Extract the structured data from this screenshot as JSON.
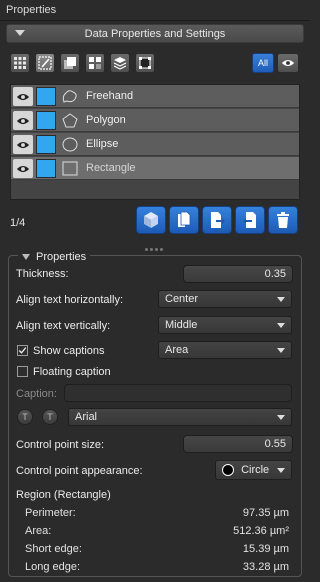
{
  "panel": {
    "title": "Properties"
  },
  "section": {
    "label": "Data Properties and Settings"
  },
  "toolbar": {
    "tools": [
      "grid-icon",
      "freehand-edit-icon",
      "overlay-icon",
      "tiles-icon",
      "layers-icon",
      "crop-icon"
    ],
    "all_label": "All"
  },
  "annotations": [
    {
      "name": "Freehand",
      "color": "#33a6f2",
      "shape": "freehand-shape-icon",
      "selected": false
    },
    {
      "name": "Polygon",
      "color": "#33a6f2",
      "shape": "polygon-shape-icon",
      "selected": false
    },
    {
      "name": "Ellipse",
      "color": "#33a6f2",
      "shape": "ellipse-shape-icon",
      "selected": false
    },
    {
      "name": "Rectangle",
      "color": "#33a6f2",
      "shape": "rectangle-shape-icon",
      "selected": true
    }
  ],
  "counter": "1/4",
  "actions": [
    "cube-icon",
    "copy-icon",
    "export-icon",
    "import-icon",
    "delete-icon"
  ],
  "properties": {
    "legend": "Properties",
    "thickness_label": "Thickness:",
    "thickness_value": "0.35",
    "align_h_label": "Align text horizontally:",
    "align_h_value": "Center",
    "align_v_label": "Align text vertically:",
    "align_v_value": "Middle",
    "show_captions_label": "Show captions",
    "show_captions_checked": true,
    "captions_mode": "Area",
    "floating_caption_label": "Floating caption",
    "floating_caption_checked": false,
    "caption_label": "Caption:",
    "caption_value": "",
    "font_value": "Arial",
    "font_btn_1": "T",
    "font_btn_2": "T",
    "cp_size_label": "Control point size:",
    "cp_size_value": "0.55",
    "cp_appearance_label": "Control point appearance:",
    "cp_appearance_value": "Circle",
    "region_title": "Region (Rectangle)",
    "stats": [
      {
        "label": "Perimeter:",
        "value": "97.35 µm"
      },
      {
        "label": "Area:",
        "value": "512.36 µm²"
      },
      {
        "label": "Short edge:",
        "value": "15.39 µm"
      },
      {
        "label": "Long edge:",
        "value": "33.28 µm"
      }
    ]
  },
  "colors": {
    "accent": "#2a6fc9",
    "swatch": "#33a6f2",
    "background": "#2b2b2b"
  }
}
